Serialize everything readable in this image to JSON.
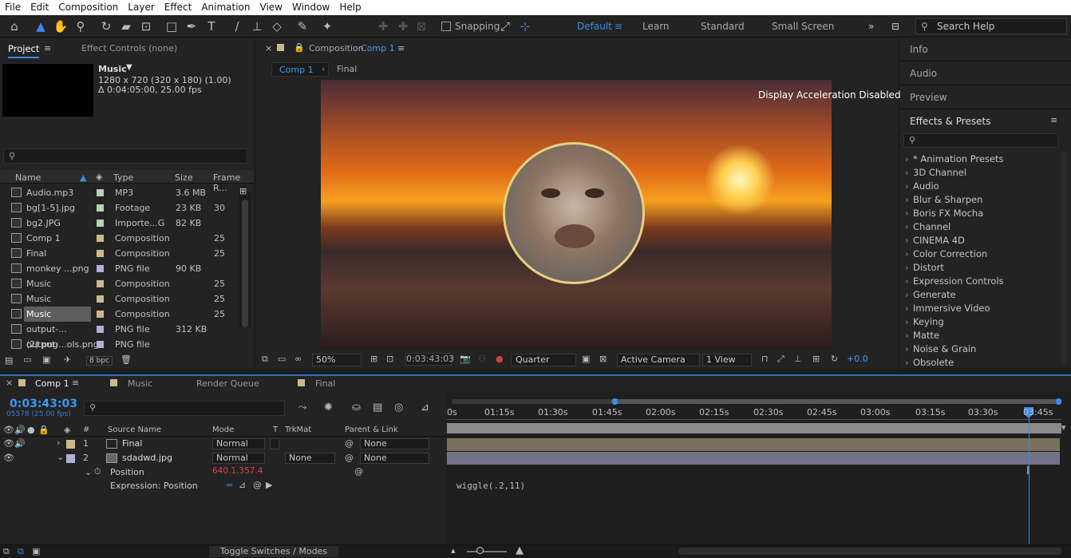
{
  "menu": [
    "File",
    "Edit",
    "Composition",
    "Layer",
    "Effect",
    "Animation",
    "View",
    "Window",
    "Help"
  ],
  "toolbar": {
    "snapping_label": "Snapping",
    "workspaces": [
      "Default",
      "Learn",
      "Standard",
      "Small Screen"
    ],
    "active_workspace": "Default",
    "search_help_placeholder": "Search Help"
  },
  "project_panel": {
    "tab_project": "Project",
    "tab_effect_controls": "Effect Controls (none)",
    "selected_name": "Music",
    "selected_info_1": "1280 x 720  (320 x 180) (1.00)",
    "selected_info_2": "Δ 0:04:05:00, 25.00 fps",
    "columns": {
      "name": "Name",
      "type": "Type",
      "size": "Size",
      "frame_rate": "Frame R..."
    },
    "bpc": "8 bpc",
    "items": [
      {
        "name": "Audio.mp3",
        "type": "MP3",
        "size": "3.6 MB",
        "rate": "",
        "color": "#b7d4b0"
      },
      {
        "name": "bg[1-5].jpg",
        "type": "Footage",
        "size": "23 KB",
        "rate": "30",
        "color": "#b7d4b0"
      },
      {
        "name": "bg2.JPG",
        "type": "Importe...G",
        "size": "82 KB",
        "rate": "",
        "color": "#b7d4b0"
      },
      {
        "name": "Comp 1",
        "type": "Composition",
        "size": "",
        "rate": "25",
        "color": "#cdb88a"
      },
      {
        "name": "Final",
        "type": "Composition",
        "size": "",
        "rate": "25",
        "color": "#cdb88a"
      },
      {
        "name": "monkey ...png",
        "type": "PNG file",
        "size": "90 KB",
        "rate": "",
        "color": "#b0b0d8"
      },
      {
        "name": "Music",
        "type": "Composition",
        "size": "",
        "rate": "25",
        "color": "#cdb88a"
      },
      {
        "name": "Music",
        "type": "Composition",
        "size": "",
        "rate": "25",
        "color": "#cdb88a"
      },
      {
        "name": "Music",
        "type": "Composition",
        "size": "",
        "rate": "25",
        "color": "#cdb88a"
      },
      {
        "name": "output-...(2).png",
        "type": "PNG file",
        "size": "312 KB",
        "rate": "",
        "color": "#b0b0d8"
      },
      {
        "name": "output-...ols.png",
        "type": "PNG file",
        "size": "",
        "rate": "",
        "color": "#b0b0d8"
      }
    ]
  },
  "composition_panel": {
    "title_prefix": "Composition",
    "title_comp": "Comp 1",
    "breadcrumb": [
      "Comp 1",
      "Final"
    ],
    "acceleration_msg": "Display Acceleration Disabled",
    "zoom": "50%",
    "timecode": "0:03:43:03",
    "resolution": "Quarter",
    "camera": "Active Camera",
    "views": "1 View",
    "exposure": "+0.0"
  },
  "right_panels": {
    "info": "Info",
    "audio": "Audio",
    "preview": "Preview",
    "effects_presets": "Effects & Presets",
    "effects": [
      "* Animation Presets",
      "3D Channel",
      "Audio",
      "Blur & Sharpen",
      "Boris FX Mocha",
      "Channel",
      "CINEMA 4D",
      "Color Correction",
      "Distort",
      "Expression Controls",
      "Generate",
      "Immersive Video",
      "Keying",
      "Matte",
      "Noise & Grain",
      "Obsolete"
    ]
  },
  "timeline": {
    "tabs": [
      "Comp 1",
      "Music",
      "Render Queue",
      "Final"
    ],
    "active_tab": "Comp 1",
    "timecode": "0:03:43:03",
    "frame_info": "05578 (25.00 fps)",
    "columns": {
      "hash": "#",
      "source": "Source Name",
      "mode": "Mode",
      "t": "T",
      "trkmat": "TrkMat",
      "parent": "Parent & Link"
    },
    "ruler": [
      "0s",
      "01:15s",
      "01:30s",
      "01:45s",
      "02:00s",
      "02:15s",
      "02:30s",
      "02:45s",
      "03:00s",
      "03:15s",
      "03:30s",
      "03:45s"
    ],
    "layers": [
      {
        "index": "1",
        "name": "Final",
        "mode": "Normal",
        "trkmat": "",
        "parent": "None"
      },
      {
        "index": "2",
        "name": "sdadwd.jpg",
        "mode": "Normal",
        "trkmat": "None",
        "parent": "None"
      }
    ],
    "property_name": "Position",
    "property_value": "640.1,357.4",
    "expression_label": "Expression: Position",
    "expression_text": "wiggle(.2,11)",
    "toggle_label": "Toggle Switches / Modes"
  }
}
